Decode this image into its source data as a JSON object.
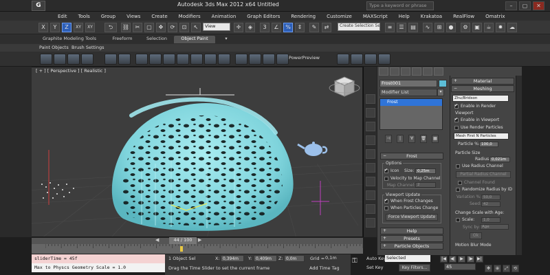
{
  "window": {
    "logo_text": "G",
    "title": "Autodesk 3ds Max  2012 x64       Untitled",
    "search_placeholder": "Type a keyword or phrase",
    "controls": [
      "–",
      "▢",
      "✕"
    ]
  },
  "menu": [
    "Edit",
    "Tools",
    "Group",
    "Views",
    "Create",
    "Modifiers",
    "Animation",
    "Graph Editors",
    "Rendering",
    "Customize",
    "MAXScript",
    "Help",
    "Krakatoa",
    "RealFlow",
    "Omatrix"
  ],
  "toolbar": {
    "axis_buttons": [
      "X",
      "Y",
      "Z",
      "XY",
      "XY"
    ],
    "active_axis": "Z",
    "view_dropdown": "View",
    "selection_set_placeholder": "Create Selection Se"
  },
  "ribbon": {
    "tabs": [
      "Graphite Modeling Tools",
      "Freeform",
      "Selection",
      "Object Paint"
    ],
    "active_tab": "Object Paint",
    "tab_menu_icon": "▾",
    "sub_items": [
      "Paint Objects",
      "Brush Settings"
    ],
    "power_preview": "PowerPreview"
  },
  "viewport": {
    "label": "[ + ] [ Perspective ] [ Realistic ]",
    "mesh_color": "#7fd4dc",
    "background": "#3d3d3d"
  },
  "command_panel": {
    "object_name": "Frost001",
    "object_color": "#5cbdd6",
    "modifier_list": "Modifier List",
    "stack_items": [
      "Frost"
    ],
    "stack_tools": [
      "⊣",
      "|",
      "∀",
      "🗑",
      "▦"
    ],
    "frost_rollout": "Frost",
    "options_group": "Options",
    "icon_label": "Icon",
    "icon_checked": true,
    "size_label": "Size:",
    "size_value": "0,25m",
    "velocity_label": "Velocity to Map Channel",
    "velocity_checked": false,
    "map_channel_label": "Map Channel:",
    "map_channel_value": "2",
    "viewport_update_group": "Viewport Update",
    "when_frost_changes": "When Frost Changes",
    "when_frost_changes_checked": true,
    "when_particles_change": "When Particles Change",
    "when_particles_change_checked": false,
    "force_update": "Force Viewport Update",
    "help_rollout": "Help",
    "presets_rollout": "Presets",
    "particle_objects_rollout": "Particle Objects"
  },
  "material_panel": {
    "material_rollout": "Material",
    "meshing_rollout": "Meshing",
    "method": "Zhu/Bridson",
    "enable_in_render": "Enable in Render",
    "enable_in_render_checked": true,
    "viewport_group": "Viewport",
    "enable_in_viewport": "Enable in Viewport",
    "enable_in_viewport_checked": true,
    "use_render_particles": "Use Render Particles",
    "use_render_particles_checked": false,
    "mesh_mode": "Mesh First N Particles",
    "particle_pct_label": "Particle %:",
    "particle_pct_value": "100,0",
    "particle_size_group": "Particle Size",
    "radius_label": "Radius:",
    "radius_value": "0,021m",
    "use_radius_channel": "Use Radius Channel",
    "use_radius_channel_checked": false,
    "partial_radius_channel": "Partial Radius Channel",
    "channel_found": "Channel Found",
    "randomize_radius": "Randomize Radius by ID",
    "randomize_radius_checked": false,
    "variation_label": "Variation %:",
    "variation_value": "50,0",
    "seed_label": "Seed:",
    "seed_value": "42",
    "change_scale_group": "Change Scale with Age:",
    "scale_label": "Scale:",
    "scale_value": "1,0",
    "scale_checked": false,
    "sync_by_label": "Sync by:",
    "sync_by_value": "Age",
    "ok_label": "Ok",
    "motion_blur_group": "Motion Blur Mode"
  },
  "timeline": {
    "frame_display": "44 / 100",
    "prev_icon": "◀",
    "next_icon": "▶",
    "current_frame": 44,
    "total_frames": 100
  },
  "maxscript": {
    "line1": "sliderTime = 45f",
    "line2": "Max to Physcs Geometry Scale = 1.0"
  },
  "status": {
    "selection_count": "1 Object Sel",
    "hint": "Drag the Time Slider to set the current frame",
    "coords": [
      {
        "label": "X:",
        "value": "0,394m"
      },
      {
        "label": "Y:",
        "value": "0,409m"
      },
      {
        "label": "Z:",
        "value": "0,0m"
      }
    ],
    "grid_label": "Grid =",
    "grid_value": "0,1m",
    "add_time_tag": "Add Time Tag"
  },
  "animation": {
    "key_icon": "⚿",
    "auto_key": "Auto Key",
    "set_key": "Set Key",
    "selected": "Selected",
    "key_filters": "Key Filters...",
    "frame": "45",
    "playback": [
      "|◀",
      "◀|",
      "▶",
      "|▶",
      "▶|"
    ],
    "nav_icons": [
      "✥",
      "⊕",
      "⤢",
      "⟲"
    ]
  }
}
